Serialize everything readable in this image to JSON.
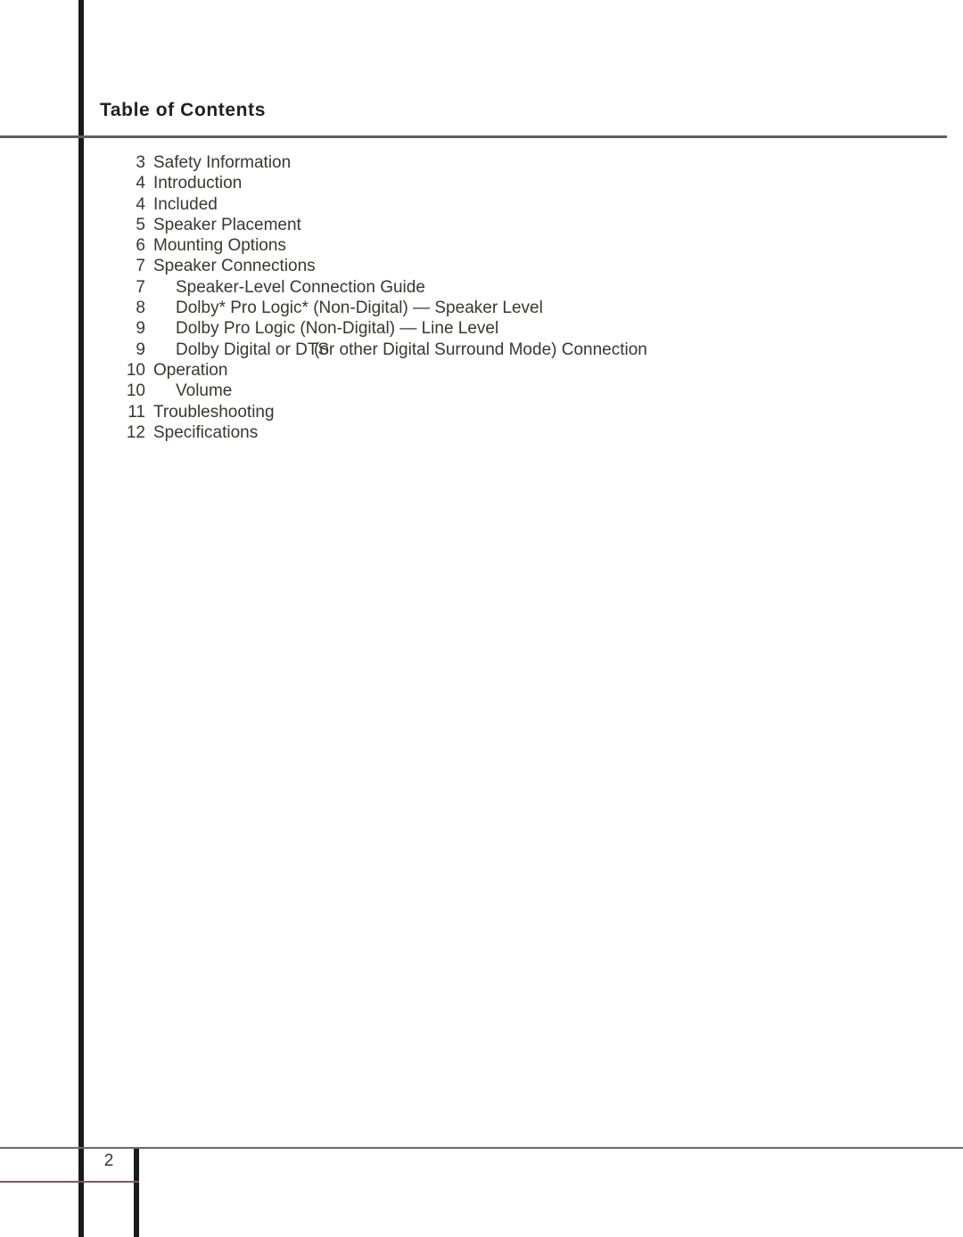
{
  "document": {
    "heading": "Table of Contents",
    "footer_page_number": "2"
  },
  "toc": {
    "entries": [
      {
        "page": "3",
        "label": "Safety Information",
        "level": 1
      },
      {
        "page": "4",
        "label": "Introduction",
        "level": 1
      },
      {
        "page": "4",
        "label": "Included",
        "level": 1
      },
      {
        "page": "5",
        "label": "Speaker Placement",
        "level": 1
      },
      {
        "page": "6",
        "label": "Mounting Options",
        "level": 1
      },
      {
        "page": "7",
        "label": "Speaker Connections",
        "level": 1
      },
      {
        "page": "7",
        "label": "Speaker-Level Connection Guide",
        "level": 2
      },
      {
        "page": "8",
        "label": "Dolby* Pro Logic* (Non-Digital) — Speaker Level",
        "level": 2
      },
      {
        "page": "9",
        "label": "Dolby Pro Logic (Non-Digital) — Line Level",
        "level": 2
      },
      {
        "page": "9",
        "label": "Dolby Digital or DTS",
        "label_overlap": "(or other Digital Surround Mode) Connection",
        "level": 2
      },
      {
        "page": "10",
        "label": "Operation",
        "level": 1
      },
      {
        "page": "10",
        "label": "Volume",
        "level": 2
      },
      {
        "page": "11",
        "label": "Troubleshooting",
        "level": 1
      },
      {
        "page": "12",
        "label": "Specifications",
        "level": 1
      }
    ]
  }
}
